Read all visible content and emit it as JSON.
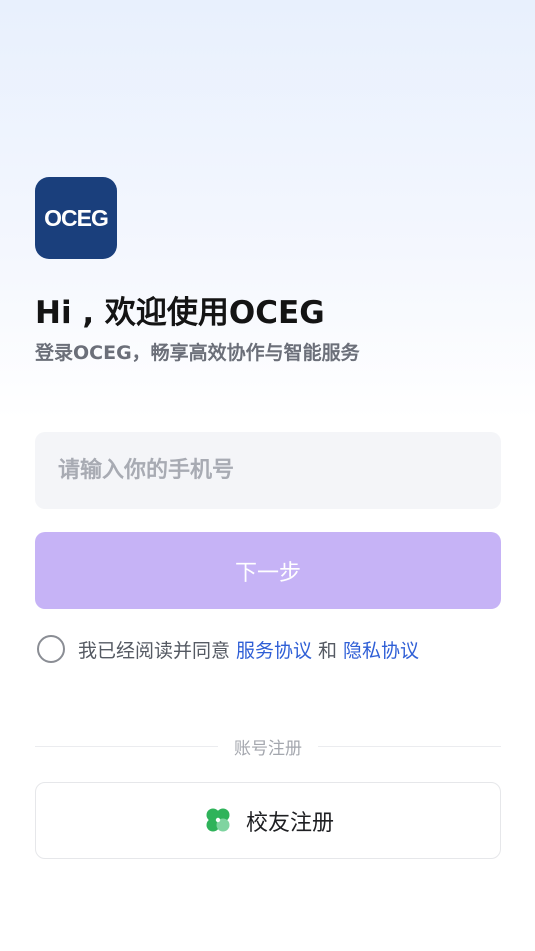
{
  "app": {
    "logo_text": "OCEG",
    "logo_color": "#1a3f7c"
  },
  "header": {
    "title": "Hi , 欢迎使用OCEG",
    "subtitle": "登录OCEG，畅享高效协作与智能服务"
  },
  "form": {
    "phone_placeholder": "请输入你的手机号",
    "phone_value": "",
    "next_label": "下一步",
    "next_color": "#c6b3f6"
  },
  "agreement": {
    "checked": false,
    "prefix": "我已经阅读并同意",
    "terms_link": "服务协议",
    "and": "和",
    "privacy_link": "隐私协议",
    "link_color": "#2f5fd6"
  },
  "register": {
    "divider_label": "账号注册",
    "alumni_label": "校友注册",
    "alumni_icon": "clover-icon",
    "icon_color": "#2fb35a"
  }
}
